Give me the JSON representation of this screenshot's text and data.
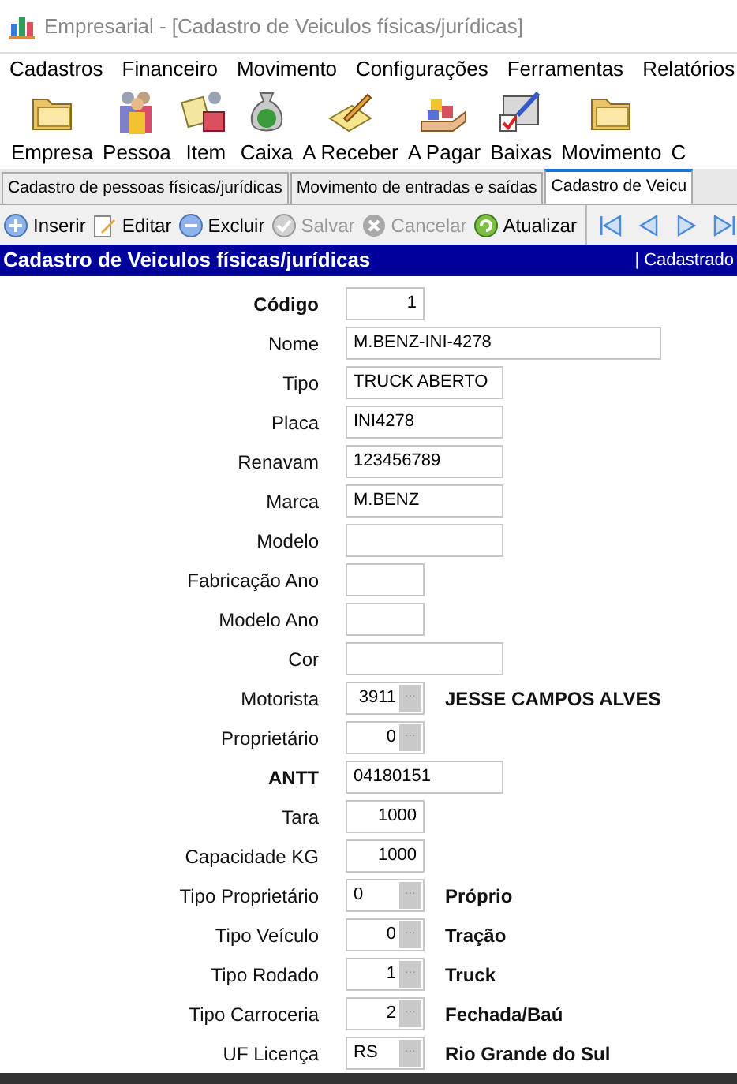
{
  "window": {
    "title": "Empresarial - [Cadastro de Veiculos físicas/jurídicas]"
  },
  "menu": [
    "Cadastros",
    "Financeiro",
    "Movimento",
    "Configurações",
    "Ferramentas",
    "Relatórios"
  ],
  "toolbar": [
    {
      "label": "Empresa",
      "kind": "folder"
    },
    {
      "label": "Pessoa",
      "kind": "people"
    },
    {
      "label": "Item",
      "kind": "item"
    },
    {
      "label": "Caixa",
      "kind": "money"
    },
    {
      "label": "A Receber",
      "kind": "pencil"
    },
    {
      "label": "A Pagar",
      "kind": "boxes"
    },
    {
      "label": "Baixas",
      "kind": "check"
    },
    {
      "label": "Movimento",
      "kind": "folder"
    },
    {
      "label": "C",
      "kind": "none"
    }
  ],
  "tabs": [
    {
      "label": "Cadastro de pessoas físicas/jurídicas",
      "selected": false
    },
    {
      "label": "Movimento de entradas e saídas",
      "selected": false
    },
    {
      "label": "Cadastro de Veicu",
      "selected": true
    }
  ],
  "actions": [
    {
      "label": "Inserir",
      "kind": "plus",
      "disabled": false
    },
    {
      "label": "Editar",
      "kind": "edit",
      "disabled": false
    },
    {
      "label": "Excluir",
      "kind": "minus",
      "disabled": false
    },
    {
      "label": "Salvar",
      "kind": "ok",
      "disabled": true
    },
    {
      "label": "Cancelar",
      "kind": "cancel",
      "disabled": true
    },
    {
      "label": "Atualizar",
      "kind": "refresh",
      "disabled": false
    }
  ],
  "navigation": [
    {
      "kind": "first"
    },
    {
      "kind": "prev"
    },
    {
      "kind": "next"
    },
    {
      "kind": "last"
    }
  ],
  "header": {
    "title": "Cadastro de Veiculos físicas/jurídicas",
    "status": "| Cadastrado"
  },
  "form": [
    {
      "label": "Código",
      "bold": true,
      "kind": "number",
      "value": "1"
    },
    {
      "label": "Nome",
      "bold": false,
      "kind": "long",
      "value": "M.BENZ-INI-4278"
    },
    {
      "label": "Tipo",
      "bold": false,
      "kind": "medium",
      "value": "TRUCK ABERTO"
    },
    {
      "label": "Placa",
      "bold": false,
      "kind": "medium",
      "value": "INI4278"
    },
    {
      "label": "Renavam",
      "bold": false,
      "kind": "medium",
      "value": "123456789"
    },
    {
      "label": "Marca",
      "bold": false,
      "kind": "medium",
      "value": "M.BENZ"
    },
    {
      "label": "Modelo",
      "bold": false,
      "kind": "medium"
    },
    {
      "label": "Fabricação Ano",
      "bold": false,
      "kind": "short"
    },
    {
      "label": "Modelo Ano",
      "bold": false,
      "kind": "short"
    },
    {
      "label": "Cor",
      "bold": false,
      "kind": "medium"
    },
    {
      "label": "Motorista",
      "bold": false,
      "kind": "lookup",
      "value": "3911",
      "button": "···",
      "description": "JESSE CAMPOS ALVES"
    },
    {
      "label": "Proprietário",
      "bold": false,
      "kind": "lookup",
      "value": "0",
      "button": "···"
    },
    {
      "label": "ANTT",
      "bold": true,
      "kind": "medium",
      "value": "04180151"
    },
    {
      "label": "Tara",
      "bold": false,
      "kind": "number",
      "value": "1000"
    },
    {
      "label": "Capacidade KG",
      "bold": false,
      "kind": "number",
      "value": "1000"
    },
    {
      "label": "Tipo Proprietário",
      "bold": false,
      "kind": "codelookup",
      "value": "0",
      "button": "···",
      "description": "Próprio"
    },
    {
      "label": "Tipo Veículo",
      "bold": false,
      "kind": "lookup",
      "value": "0",
      "button": "···",
      "description": "Tração"
    },
    {
      "label": "Tipo Rodado",
      "bold": false,
      "kind": "lookup",
      "value": "1",
      "button": "···",
      "description": "Truck"
    },
    {
      "label": "Tipo Carroceria",
      "bold": false,
      "kind": "lookup",
      "value": "2",
      "button": "···",
      "description": "Fechada/Baú"
    },
    {
      "label": "UF Licença",
      "bold": false,
      "kind": "codelookup",
      "value": "RS",
      "button": "···",
      "description": "Rio Grande do Sul"
    }
  ]
}
